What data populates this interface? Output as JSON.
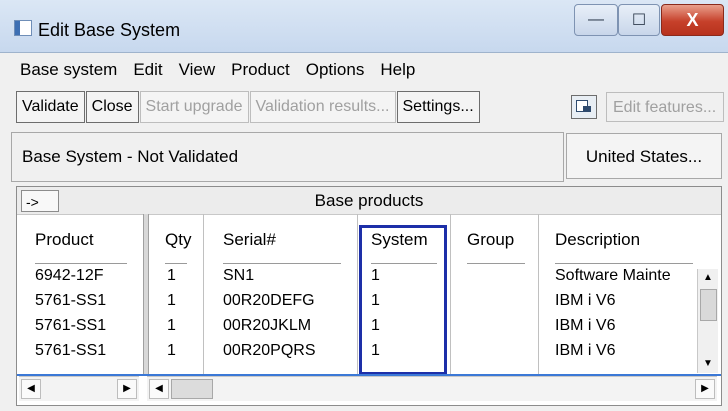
{
  "window": {
    "title": "Edit Base System",
    "minimize_symbol": "—",
    "maximize_symbol": "☐",
    "close_symbol": "X"
  },
  "menu": [
    "Base system",
    "Edit",
    "View",
    "Product",
    "Options",
    "Help"
  ],
  "toolbar": {
    "validate": "Validate",
    "close": "Close",
    "start_upgrade": "Start upgrade",
    "validation_results": "Validation results...",
    "settings": "Settings...",
    "edit_features": "Edit features..."
  },
  "status": {
    "text": "Base System - Not Validated",
    "country": "United States..."
  },
  "grid": {
    "arrow_label": "->",
    "group_title": "Base products",
    "columns": [
      "Product",
      "Qty",
      "Serial#",
      "System",
      "Group",
      "Description"
    ],
    "rows": [
      {
        "product": "6942-12F",
        "qty": "1",
        "serial": "SN1",
        "system": "1",
        "group": "",
        "description": "Software Mainte"
      },
      {
        "product": "5761-SS1",
        "qty": "1",
        "serial": "00R20DEFG",
        "system": "1",
        "group": "",
        "description": "IBM i V6"
      },
      {
        "product": "5761-SS1",
        "qty": "1",
        "serial": "00R20JKLM",
        "system": "1",
        "group": "",
        "description": "IBM i V6"
      },
      {
        "product": "5761-SS1",
        "qty": "1",
        "serial": "00R20PQRS",
        "system": "1",
        "group": "",
        "description": "IBM i V6"
      }
    ]
  },
  "icons": {
    "app": "app-window-icon",
    "toolbar_edit": "edit-features-icon",
    "scroll_up": "▲",
    "scroll_down": "▼",
    "scroll_left": "◀",
    "scroll_right": "▶"
  },
  "colors": {
    "selection_border": "#1d2fa8",
    "close_button": "#c6402a"
  }
}
